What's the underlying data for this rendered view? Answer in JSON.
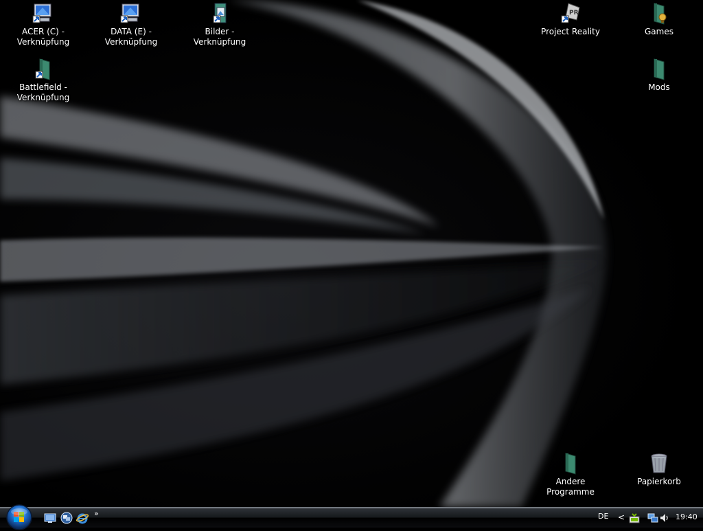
{
  "desktop": {
    "icons": [
      {
        "label": "ACER (C) -\nVerknüpfung",
        "icon": "drive-shortcut-icon"
      },
      {
        "label": "DATA (E) -\nVerknüpfung",
        "icon": "drive-shortcut-icon"
      },
      {
        "label": "Bilder - Verknüpfung",
        "icon": "pictures-shortcut-icon"
      },
      {
        "label": "Project Reality",
        "icon": "game-shortcut-icon"
      },
      {
        "label": "Games",
        "icon": "folder-icon"
      },
      {
        "label": "Battlefield -\nVerknüpfung",
        "icon": "folder-shortcut-icon"
      },
      {
        "label": "Mods",
        "icon": "folder-icon"
      },
      {
        "label": "Andere Programme",
        "icon": "folder-icon"
      },
      {
        "label": "Papierkorb",
        "icon": "recycle-bin-icon"
      }
    ]
  },
  "taskbar": {
    "quick_launch": [
      "show-desktop-icon",
      "window-switcher-icon",
      "internet-explorer-icon"
    ],
    "overflow": "»",
    "language": "DE",
    "tray_overflow": "<",
    "tray_icons": [
      "nvidia-icon",
      "network-icon",
      "volume-icon"
    ],
    "clock": "19:40"
  },
  "colors": {
    "taskbar": "#15181b",
    "desktop": "#000000",
    "start_orb": "#1f6fd0"
  }
}
